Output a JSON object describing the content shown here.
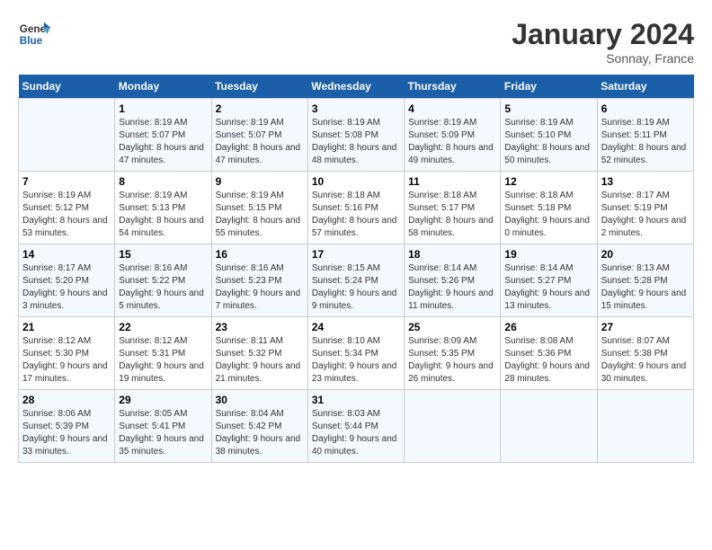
{
  "header": {
    "logo_line1": "General",
    "logo_line2": "Blue",
    "month_title": "January 2024",
    "location": "Sonnay, France"
  },
  "weekdays": [
    "Sunday",
    "Monday",
    "Tuesday",
    "Wednesday",
    "Thursday",
    "Friday",
    "Saturday"
  ],
  "weeks": [
    [
      {
        "day": "",
        "sunrise": "",
        "sunset": "",
        "daylight": ""
      },
      {
        "day": "1",
        "sunrise": "Sunrise: 8:19 AM",
        "sunset": "Sunset: 5:07 PM",
        "daylight": "Daylight: 8 hours and 47 minutes."
      },
      {
        "day": "2",
        "sunrise": "Sunrise: 8:19 AM",
        "sunset": "Sunset: 5:07 PM",
        "daylight": "Daylight: 8 hours and 47 minutes."
      },
      {
        "day": "3",
        "sunrise": "Sunrise: 8:19 AM",
        "sunset": "Sunset: 5:08 PM",
        "daylight": "Daylight: 8 hours and 48 minutes."
      },
      {
        "day": "4",
        "sunrise": "Sunrise: 8:19 AM",
        "sunset": "Sunset: 5:09 PM",
        "daylight": "Daylight: 8 hours and 49 minutes."
      },
      {
        "day": "5",
        "sunrise": "Sunrise: 8:19 AM",
        "sunset": "Sunset: 5:10 PM",
        "daylight": "Daylight: 8 hours and 50 minutes."
      },
      {
        "day": "6",
        "sunrise": "Sunrise: 8:19 AM",
        "sunset": "Sunset: 5:11 PM",
        "daylight": "Daylight: 8 hours and 52 minutes."
      }
    ],
    [
      {
        "day": "7",
        "sunrise": "Sunrise: 8:19 AM",
        "sunset": "Sunset: 5:12 PM",
        "daylight": "Daylight: 8 hours and 53 minutes."
      },
      {
        "day": "8",
        "sunrise": "Sunrise: 8:19 AM",
        "sunset": "Sunset: 5:13 PM",
        "daylight": "Daylight: 8 hours and 54 minutes."
      },
      {
        "day": "9",
        "sunrise": "Sunrise: 8:19 AM",
        "sunset": "Sunset: 5:15 PM",
        "daylight": "Daylight: 8 hours and 55 minutes."
      },
      {
        "day": "10",
        "sunrise": "Sunrise: 8:18 AM",
        "sunset": "Sunset: 5:16 PM",
        "daylight": "Daylight: 8 hours and 57 minutes."
      },
      {
        "day": "11",
        "sunrise": "Sunrise: 8:18 AM",
        "sunset": "Sunset: 5:17 PM",
        "daylight": "Daylight: 8 hours and 58 minutes."
      },
      {
        "day": "12",
        "sunrise": "Sunrise: 8:18 AM",
        "sunset": "Sunset: 5:18 PM",
        "daylight": "Daylight: 9 hours and 0 minutes."
      },
      {
        "day": "13",
        "sunrise": "Sunrise: 8:17 AM",
        "sunset": "Sunset: 5:19 PM",
        "daylight": "Daylight: 9 hours and 2 minutes."
      }
    ],
    [
      {
        "day": "14",
        "sunrise": "Sunrise: 8:17 AM",
        "sunset": "Sunset: 5:20 PM",
        "daylight": "Daylight: 9 hours and 3 minutes."
      },
      {
        "day": "15",
        "sunrise": "Sunrise: 8:16 AM",
        "sunset": "Sunset: 5:22 PM",
        "daylight": "Daylight: 9 hours and 5 minutes."
      },
      {
        "day": "16",
        "sunrise": "Sunrise: 8:16 AM",
        "sunset": "Sunset: 5:23 PM",
        "daylight": "Daylight: 9 hours and 7 minutes."
      },
      {
        "day": "17",
        "sunrise": "Sunrise: 8:15 AM",
        "sunset": "Sunset: 5:24 PM",
        "daylight": "Daylight: 9 hours and 9 minutes."
      },
      {
        "day": "18",
        "sunrise": "Sunrise: 8:14 AM",
        "sunset": "Sunset: 5:26 PM",
        "daylight": "Daylight: 9 hours and 11 minutes."
      },
      {
        "day": "19",
        "sunrise": "Sunrise: 8:14 AM",
        "sunset": "Sunset: 5:27 PM",
        "daylight": "Daylight: 9 hours and 13 minutes."
      },
      {
        "day": "20",
        "sunrise": "Sunrise: 8:13 AM",
        "sunset": "Sunset: 5:28 PM",
        "daylight": "Daylight: 9 hours and 15 minutes."
      }
    ],
    [
      {
        "day": "21",
        "sunrise": "Sunrise: 8:12 AM",
        "sunset": "Sunset: 5:30 PM",
        "daylight": "Daylight: 9 hours and 17 minutes."
      },
      {
        "day": "22",
        "sunrise": "Sunrise: 8:12 AM",
        "sunset": "Sunset: 5:31 PM",
        "daylight": "Daylight: 9 hours and 19 minutes."
      },
      {
        "day": "23",
        "sunrise": "Sunrise: 8:11 AM",
        "sunset": "Sunset: 5:32 PM",
        "daylight": "Daylight: 9 hours and 21 minutes."
      },
      {
        "day": "24",
        "sunrise": "Sunrise: 8:10 AM",
        "sunset": "Sunset: 5:34 PM",
        "daylight": "Daylight: 9 hours and 23 minutes."
      },
      {
        "day": "25",
        "sunrise": "Sunrise: 8:09 AM",
        "sunset": "Sunset: 5:35 PM",
        "daylight": "Daylight: 9 hours and 26 minutes."
      },
      {
        "day": "26",
        "sunrise": "Sunrise: 8:08 AM",
        "sunset": "Sunset: 5:36 PM",
        "daylight": "Daylight: 9 hours and 28 minutes."
      },
      {
        "day": "27",
        "sunrise": "Sunrise: 8:07 AM",
        "sunset": "Sunset: 5:38 PM",
        "daylight": "Daylight: 9 hours and 30 minutes."
      }
    ],
    [
      {
        "day": "28",
        "sunrise": "Sunrise: 8:06 AM",
        "sunset": "Sunset: 5:39 PM",
        "daylight": "Daylight: 9 hours and 33 minutes."
      },
      {
        "day": "29",
        "sunrise": "Sunrise: 8:05 AM",
        "sunset": "Sunset: 5:41 PM",
        "daylight": "Daylight: 9 hours and 35 minutes."
      },
      {
        "day": "30",
        "sunrise": "Sunrise: 8:04 AM",
        "sunset": "Sunset: 5:42 PM",
        "daylight": "Daylight: 9 hours and 38 minutes."
      },
      {
        "day": "31",
        "sunrise": "Sunrise: 8:03 AM",
        "sunset": "Sunset: 5:44 PM",
        "daylight": "Daylight: 9 hours and 40 minutes."
      },
      {
        "day": "",
        "sunrise": "",
        "sunset": "",
        "daylight": ""
      },
      {
        "day": "",
        "sunrise": "",
        "sunset": "",
        "daylight": ""
      },
      {
        "day": "",
        "sunrise": "",
        "sunset": "",
        "daylight": ""
      }
    ]
  ]
}
